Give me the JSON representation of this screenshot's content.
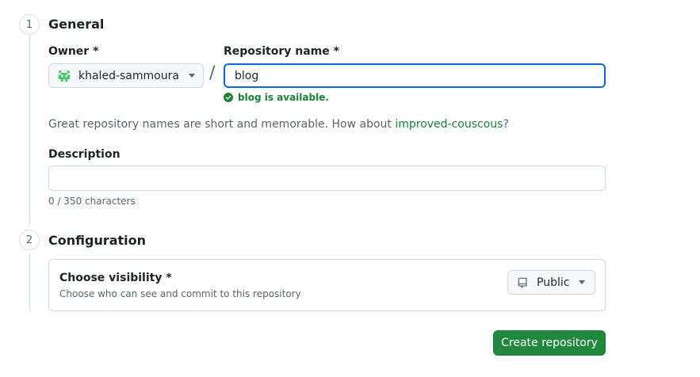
{
  "general": {
    "step_number": "1",
    "title": "General",
    "owner_label": "Owner *",
    "owner_value": "khaled-sammoura",
    "separator": "/",
    "repo_label": "Repository name *",
    "repo_value": "blog",
    "availability_message": "blog is available.",
    "suggestion_prefix": "Great repository names are short and memorable. How about ",
    "suggestion_name": "improved-couscous",
    "suggestion_suffix": "?",
    "description_label": "Description",
    "description_value": "",
    "char_count": "0 / 350 characters"
  },
  "configuration": {
    "step_number": "2",
    "title": "Configuration",
    "visibility_title": "Choose visibility *",
    "visibility_subtitle": "Choose who can see and commit to this repository",
    "visibility_value": "Public"
  },
  "actions": {
    "create_label": "Create repository"
  },
  "colors": {
    "accent_focus": "#0969da",
    "success": "#1a7f37",
    "primary_button": "#1f883d"
  },
  "icons": {
    "owner_avatar": "identicon-avatar",
    "availability": "check-circle-icon",
    "visibility": "repo-icon",
    "dropdown": "caret-down-icon"
  }
}
